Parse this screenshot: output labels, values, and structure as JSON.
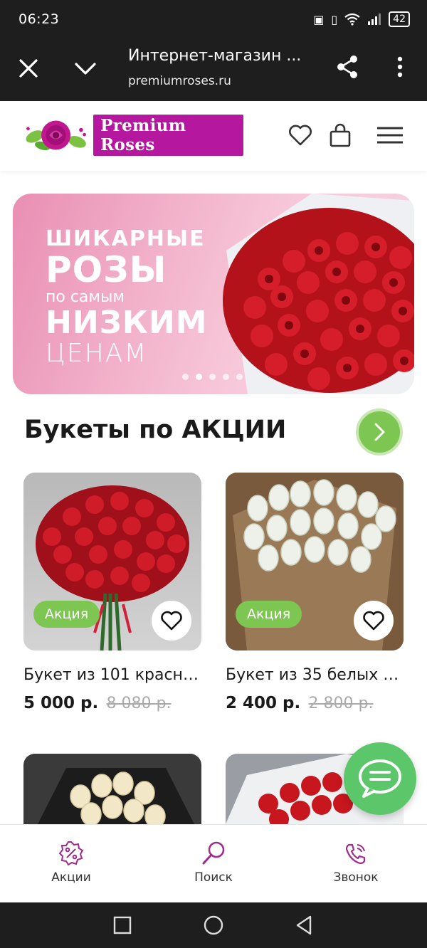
{
  "status": {
    "time": "06:23",
    "battery": "42"
  },
  "browser": {
    "title": "Интернет-магазин ...",
    "url": "premiumroses.ru"
  },
  "header": {
    "logo_text": "Premium Roses"
  },
  "banner": {
    "line1": "ШИКАРНЫЕ",
    "line2": "РОЗЫ",
    "line3": "по самым",
    "line4": "НИЗКИМ",
    "line5": "ЦЕНАМ",
    "slides": 5,
    "active_slide": 2
  },
  "section": {
    "title": "Букеты по АКЦИИ"
  },
  "products": [
    {
      "badge": "Акция",
      "name": "Букет из 101 красно...",
      "price": "5 000 р.",
      "old_price": "8 080 р.",
      "image": "red-roses-bouquet"
    },
    {
      "badge": "Акция",
      "name": "Букет из 35 белых р...",
      "price": "2 400 р.",
      "old_price": "2 800 р.",
      "image": "white-roses-bouquet"
    },
    {
      "image": "cream-roses-bouquet"
    },
    {
      "image": "red-roses-bouquet-2"
    }
  ],
  "bottom_nav": [
    {
      "label": "Акции",
      "icon": "percent-badge-icon"
    },
    {
      "label": "Поиск",
      "icon": "search-icon"
    },
    {
      "label": "Звонок",
      "icon": "phone-icon"
    }
  ],
  "colors": {
    "brand": "#b5179e",
    "accent_green": "#7ec652",
    "chat_green": "#5cc66a",
    "nav_purple": "#a02a8e"
  }
}
